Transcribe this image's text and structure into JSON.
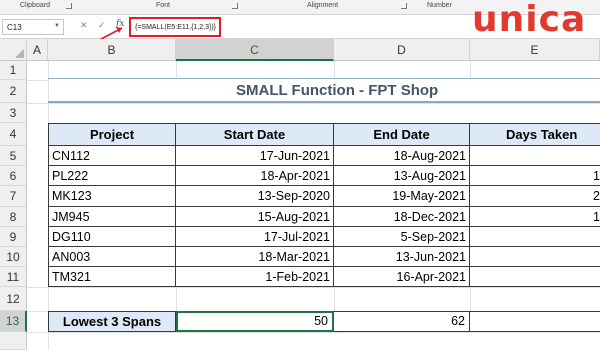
{
  "ribbon": {
    "groups": [
      "Clipboard",
      "Font",
      "Alignment",
      "Number"
    ]
  },
  "formula_bar": {
    "name_box": "C13",
    "cancel_icon": "✕",
    "enter_icon": "✓",
    "fx_label": "fx",
    "formula": "{=SMALL(E5:E11,{1,2,3})}"
  },
  "columns": [
    "A",
    "B",
    "C",
    "D",
    "E"
  ],
  "rows": [
    "1",
    "2",
    "3",
    "4",
    "5",
    "6",
    "7",
    "8",
    "9",
    "10",
    "11",
    "12",
    "13"
  ],
  "title": "SMALL Function - FPT Shop",
  "table": {
    "headers": [
      "Project",
      "Start Date",
      "End Date",
      "Days Taken"
    ],
    "rows": [
      {
        "project": "CN112",
        "start": "17-Jun-2021",
        "end": "18-Aug-2021",
        "days": ""
      },
      {
        "project": "PL222",
        "start": "18-Apr-2021",
        "end": "13-Aug-2021",
        "days": "1"
      },
      {
        "project": "MK123",
        "start": "13-Sep-2020",
        "end": "19-May-2021",
        "days": "2"
      },
      {
        "project": "JM945",
        "start": "15-Aug-2021",
        "end": "18-Dec-2021",
        "days": "1"
      },
      {
        "project": "DG110",
        "start": "17-Jul-2021",
        "end": "5-Sep-2021",
        "days": ""
      },
      {
        "project": "AN003",
        "start": "18-Mar-2021",
        "end": "13-Jun-2021",
        "days": ""
      },
      {
        "project": "TM321",
        "start": "1-Feb-2021",
        "end": "16-Apr-2021",
        "days": ""
      }
    ]
  },
  "summary": {
    "label": "Lowest 3 Spans",
    "values": [
      "50",
      "62",
      ""
    ]
  },
  "logo": "unica",
  "colors": {
    "accent_green": "#217346",
    "highlight_red": "#e01e2b",
    "header_fill": "#dde9f6",
    "title_text": "#44546a",
    "logo": "#e23a2e"
  }
}
